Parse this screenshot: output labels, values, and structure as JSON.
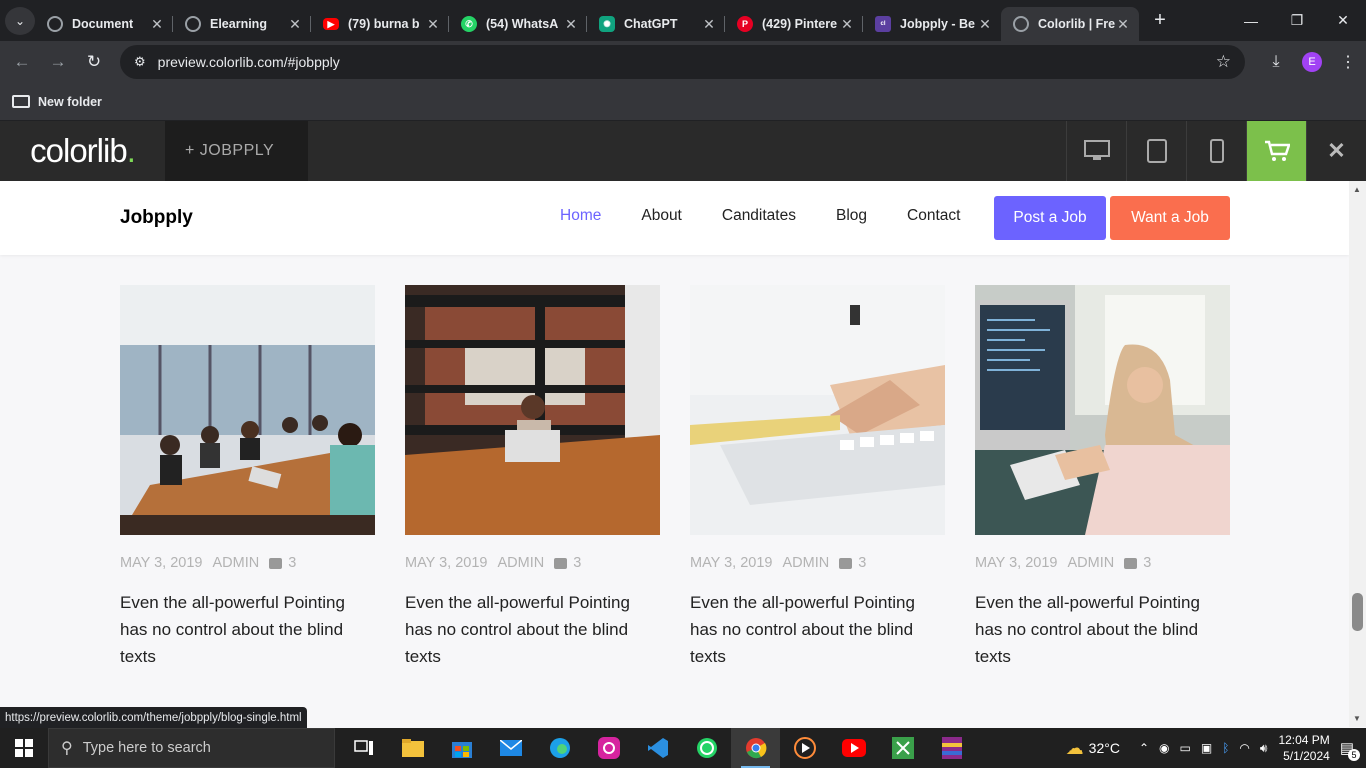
{
  "browser": {
    "tabs": [
      {
        "title": "Document",
        "favicon": "globe-icon",
        "active": false
      },
      {
        "title": "Elearning",
        "favicon": "globe-icon",
        "active": false
      },
      {
        "title": "(79) burna b",
        "favicon": "youtube-icon",
        "active": false
      },
      {
        "title": "(54) WhatsA",
        "favicon": "whatsapp-icon",
        "active": false
      },
      {
        "title": "ChatGPT",
        "favicon": "chatgpt-icon",
        "active": false
      },
      {
        "title": "(429) Pintere",
        "favicon": "pinterest-icon",
        "active": false
      },
      {
        "title": "Jobpply - Be",
        "favicon": "colorlib-icon",
        "active": false
      },
      {
        "title": "Colorlib | Fre",
        "favicon": "globe-icon",
        "active": true
      }
    ],
    "url": "preview.colorlib.com/#jobpply",
    "bookmark_folder": "New folder",
    "profile_initial": "E",
    "status_url": "https://preview.colorlib.com/theme/jobpply/blog-single.html"
  },
  "colorlib_bar": {
    "logo": "colorlib",
    "logo_dot": ".",
    "theme_label": "+  JOBPPLY"
  },
  "site": {
    "brand": "Jobpply",
    "menu": [
      "Home",
      "About",
      "Canditates",
      "Blog",
      "Contact"
    ],
    "post_job": "Post a Job",
    "want_job": "Want a Job",
    "accent": "#6c63ff",
    "orange": "#fa6e4e"
  },
  "posts": [
    {
      "date": "MAY 3, 2019",
      "author": "ADMIN",
      "comments": "3",
      "title": "Even the all-powerful Pointing has no control about the blind texts",
      "image": "meeting-room-photo"
    },
    {
      "date": "MAY 3, 2019",
      "author": "ADMIN",
      "comments": "3",
      "title": "Even the all-powerful Pointing has no control about the blind texts",
      "image": "woman-laptop-photo"
    },
    {
      "date": "MAY 3, 2019",
      "author": "ADMIN",
      "comments": "3",
      "title": "Even the all-powerful Pointing has no control about the blind texts",
      "image": "hand-keyboard-photo"
    },
    {
      "date": "MAY 3, 2019",
      "author": "ADMIN",
      "comments": "3",
      "title": "Even the all-powerful Pointing has no control about the blind texts",
      "image": "woman-computer-photo"
    }
  ],
  "taskbar": {
    "search_placeholder": "Type here to search",
    "temperature": "32°C",
    "time": "12:04 PM",
    "date": "5/1/2024",
    "notification_count": "5"
  }
}
